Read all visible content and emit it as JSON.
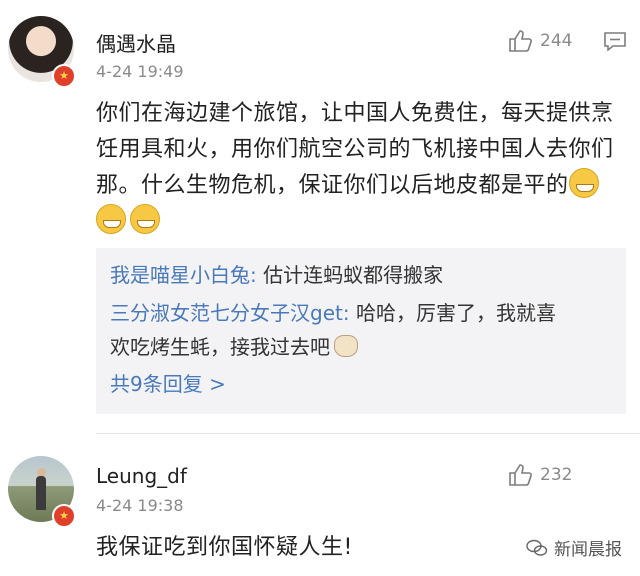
{
  "comments": [
    {
      "username": "偶遇水晶",
      "time": "4-24 19:49",
      "likes": "244",
      "text": "你们在海边建个旅馆，让中国人免费住，每天提供烹饪用具和火，用你们航空公司的飞机接中国人去你们那。什么生物危机，保证你们以后地皮都是平的",
      "replies": [
        {
          "name": "我是喵星小白兔:",
          "text": " 估计连蚂蚁都得搬家"
        },
        {
          "name": "三分淑女范七分女子汉get:",
          "text": " 哈哈，厉害了，我就喜",
          "text2": "欢吃烤生蚝，接我过去吧"
        }
      ],
      "more_replies": "共9条回复 >"
    },
    {
      "username": "Leung_df",
      "time": "4-24 19:38",
      "likes": "232",
      "text": "我保证吃到你国怀疑人生!"
    }
  ],
  "watermark": "新闻晨报",
  "colors": {
    "link": "#4a79b8",
    "badge": "#e0402a",
    "reply_bg": "#f3f3f6"
  },
  "icons": [
    "thumbs-up-icon",
    "comment-icon",
    "grin-emoji",
    "cat-emoji",
    "wechat-icon"
  ]
}
